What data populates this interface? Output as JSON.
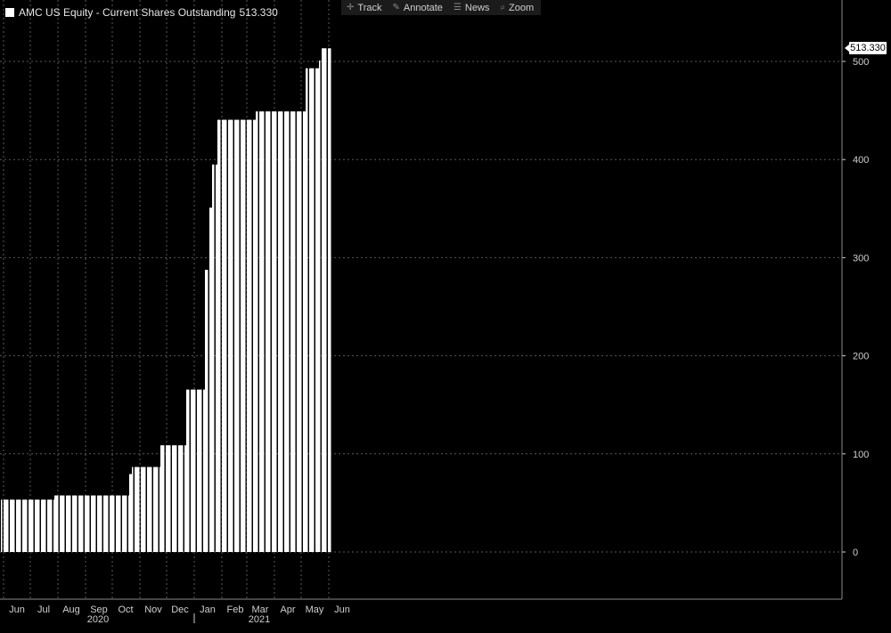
{
  "legend": {
    "label": "AMC US Equity - Current Shares Outstanding",
    "value": "513.330"
  },
  "toolbar": {
    "track": "Track",
    "annotate": "Annotate",
    "news": "News",
    "zoom": "Zoom"
  },
  "last_value_label": "513.330",
  "colors": {
    "background": "#000000",
    "bars": "#ffffff",
    "grid": "#5a5a5a",
    "text": "#cfcfcf"
  },
  "chart_data": {
    "type": "bar",
    "title": "AMC US Equity - Current Shares Outstanding",
    "xlabel": "",
    "ylabel": "",
    "ylim": [
      -50,
      560
    ],
    "yticks": [
      0,
      100,
      200,
      300,
      400,
      500
    ],
    "grid": true,
    "legend_position": "top-left",
    "month_ticks": [
      "Jun",
      "Jul",
      "Aug",
      "Sep",
      "Oct",
      "Nov",
      "Dec",
      "Jan",
      "Feb",
      "Mar",
      "Apr",
      "May",
      "Jun"
    ],
    "year_labels": [
      "2020",
      "2021"
    ],
    "series": [
      {
        "name": "Current Shares Outstanding",
        "steps": [
          {
            "start": "2020-05-29",
            "end": "2020-07-27",
            "value": 53.3
          },
          {
            "start": "2020-07-28",
            "end": "2020-10-19",
            "value": 57.6
          },
          {
            "start": "2020-10-20",
            "end": "2020-10-22",
            "value": 79.4
          },
          {
            "start": "2020-10-23",
            "end": "2020-11-23",
            "value": 86.6
          },
          {
            "start": "2020-11-24",
            "end": "2020-12-22",
            "value": 108.7
          },
          {
            "start": "2020-12-23",
            "end": "2021-01-12",
            "value": 165.5
          },
          {
            "start": "2021-01-13",
            "end": "2021-01-15",
            "value": 287.6
          },
          {
            "start": "2021-01-18",
            "end": "2021-01-20",
            "value": 350.9
          },
          {
            "start": "2021-01-21",
            "end": "2021-01-26",
            "value": 394.9
          },
          {
            "start": "2021-01-27",
            "end": "2021-03-10",
            "value": 440.5
          },
          {
            "start": "2021-03-11",
            "end": "2021-05-05",
            "value": 449.0
          },
          {
            "start": "2021-05-06",
            "end": "2021-05-20",
            "value": 493.0
          },
          {
            "start": "2021-05-21",
            "end": "2021-05-21",
            "value": 501.0
          },
          {
            "start": "2021-05-24",
            "end": "2021-06-02",
            "value": 513.33
          }
        ]
      }
    ]
  }
}
